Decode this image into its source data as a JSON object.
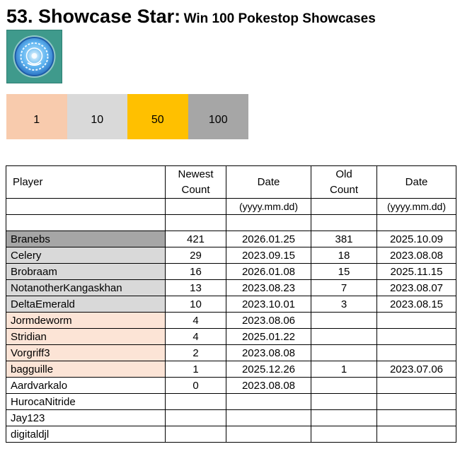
{
  "header": {
    "title_main": "53. Showcase Star:",
    "title_sub": "Win 100 Pokestop Showcases",
    "badge_icon": "showcase-medal-icon"
  },
  "tiers": [
    {
      "label": "1",
      "color": "#f8cbad"
    },
    {
      "label": "10",
      "color": "#d9d9d9"
    },
    {
      "label": "50",
      "color": "#ffc000"
    },
    {
      "label": "100",
      "color": "#a6a6a6"
    }
  ],
  "table": {
    "headers": {
      "player": "Player",
      "newest_count_1": "Newest",
      "newest_count_2": "Count",
      "date": "Date",
      "old_count_1": "Old",
      "old_count_2": "Count",
      "old_date": "Date"
    },
    "units": {
      "date": "(yyyy.mm.dd)",
      "old_date": "(yyyy.mm.dd)"
    },
    "rows": [
      {
        "player": "Branebs",
        "newest": "421",
        "date": "2026.01.25",
        "old": "381",
        "old_date": "2025.10.09",
        "tier_color": "#a6a6a6"
      },
      {
        "player": "Celery",
        "newest": "29",
        "date": "2023.09.15",
        "old": "18",
        "old_date": "2023.08.08",
        "tier_color": "#d9d9d9"
      },
      {
        "player": "Brobraam",
        "newest": "16",
        "date": "2026.01.08",
        "old": "15",
        "old_date": "2025.11.15",
        "tier_color": "#d9d9d9"
      },
      {
        "player": "NotanotherKangaskhan",
        "newest": "13",
        "date": "2023.08.23",
        "old": "7",
        "old_date": "2023.08.07",
        "tier_color": "#d9d9d9"
      },
      {
        "player": "DeltaEmerald",
        "newest": "10",
        "date": "2023.10.01",
        "old": "3",
        "old_date": "2023.08.15",
        "tier_color": "#d9d9d9"
      },
      {
        "player": "Jormdeworm",
        "newest": "4",
        "date": "2023.08.06",
        "old": "",
        "old_date": "",
        "tier_color": "#fce4d6"
      },
      {
        "player": "Stridian",
        "newest": "4",
        "date": "2025.01.22",
        "old": "",
        "old_date": "",
        "tier_color": "#fce4d6"
      },
      {
        "player": "Vorgriff3",
        "newest": "2",
        "date": "2023.08.08",
        "old": "",
        "old_date": "",
        "tier_color": "#fce4d6"
      },
      {
        "player": "bagguille",
        "newest": "1",
        "date": "2025.12.26",
        "old": "1",
        "old_date": "2023.07.06",
        "tier_color": "#fce4d6"
      },
      {
        "player": "Aardvarkalo",
        "newest": "0",
        "date": "2023.08.08",
        "old": "",
        "old_date": "",
        "tier_color": "#ffffff"
      },
      {
        "player": "HurocaNitride",
        "newest": "",
        "date": "",
        "old": "",
        "old_date": "",
        "tier_color": "#ffffff"
      },
      {
        "player": "Jay123",
        "newest": "",
        "date": "",
        "old": "",
        "old_date": "",
        "tier_color": "#ffffff"
      },
      {
        "player": "digitaldjl",
        "newest": "",
        "date": "",
        "old": "",
        "old_date": "",
        "tier_color": "#ffffff"
      }
    ]
  }
}
